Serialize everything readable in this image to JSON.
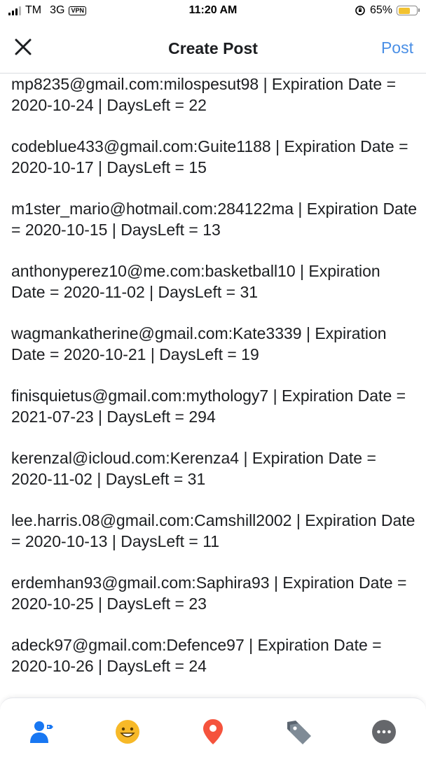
{
  "status_bar": {
    "carrier": "TM",
    "network": "3G",
    "vpn": "VPN",
    "time": "11:20 AM",
    "battery": "65%",
    "battery_level": 0.65
  },
  "header": {
    "title": "Create Post",
    "post_label": "Post"
  },
  "entries": [
    "mp8235@gmail.com:milospesut98 | Expiration Date = 2020-10-24 | DaysLeft = 22",
    "codeblue433@gmail.com:Guite1188 | Expiration Date = 2020-10-17 | DaysLeft = 15",
    "m1ster_mario@hotmail.com:284122ma | Expiration Date = 2020-10-15 | DaysLeft = 13",
    "anthonyperez10@me.com:basketball10 | Expiration Date = 2020-11-02 | DaysLeft = 31",
    "wagmankatherine@gmail.com:Kate3339 | Expiration Date = 2020-10-21 | DaysLeft = 19",
    "finisquietus@gmail.com:mythology7 | Expiration Date = 2021-07-23 | DaysLeft = 294",
    "kerenzal@icloud.com:Kerenza4 | Expiration Date = 2020-11-02 | DaysLeft = 31",
    "lee.harris.08@gmail.com:Camshill2002 | Expiration Date = 2020-10-13 | DaysLeft = 11",
    "erdemhan93@gmail.com:Saphira93 | Expiration Date = 2020-10-25 | DaysLeft = 23",
    "adeck97@gmail.com:Defence97 | Expiration Date = 2020-10-26 | DaysLeft = 24"
  ],
  "toolbar": {
    "icons": [
      "tag-people-icon",
      "feeling-icon",
      "check-in-icon",
      "tag-icon",
      "more-icon"
    ],
    "colors": {
      "tag_people": "#1877f2",
      "feeling": "#f7b928",
      "check_in": "#f5533d",
      "tag": "#45bd62",
      "more": "#65676b"
    }
  },
  "colors": {
    "accent": "#4a8fe6",
    "text": "#1c1e21",
    "divider": "#dadde1"
  }
}
